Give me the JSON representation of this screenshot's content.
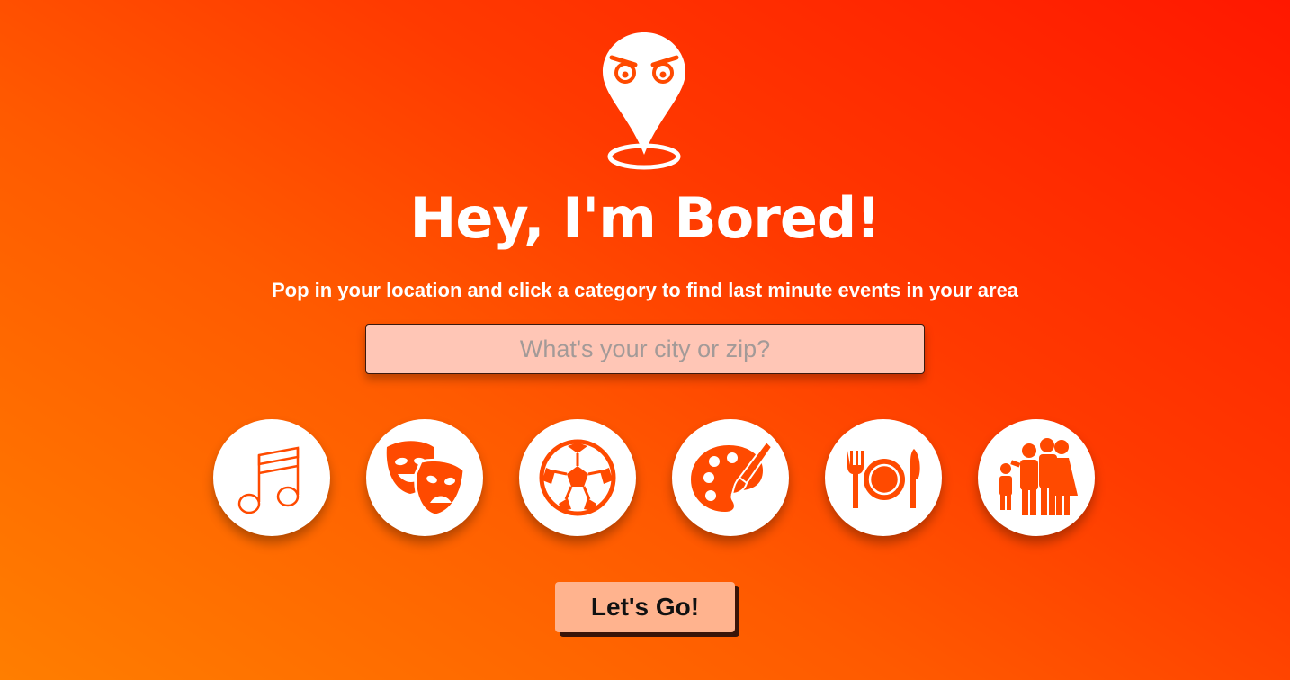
{
  "header": {
    "title": "Hey, I'm Bored!",
    "subtitle": "Pop in your location and click a category to find last minute events in your area"
  },
  "search": {
    "placeholder": "What's your city or zip?",
    "value": ""
  },
  "categories": [
    {
      "icon": "music-note-icon"
    },
    {
      "icon": "theater-masks-icon"
    },
    {
      "icon": "soccer-ball-icon"
    },
    {
      "icon": "paint-palette-icon"
    },
    {
      "icon": "dining-plate-icon"
    },
    {
      "icon": "family-icon"
    }
  ],
  "action": {
    "go_label": "Let's Go!"
  },
  "colors": {
    "accent": "#ff4a00",
    "gradient_start": "#ff7e00",
    "gradient_end": "#ff1800",
    "button_bg": "#ffb38e",
    "input_bg": "#ffc6b6"
  }
}
